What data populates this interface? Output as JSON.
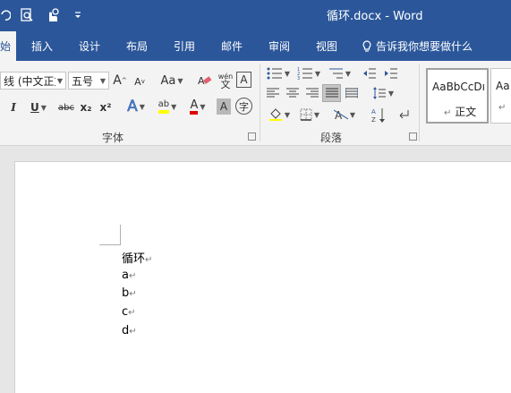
{
  "window": {
    "title": "循环.docx  -  Word",
    "colors": {
      "titlebar": "#2b579a",
      "ribbon": "#f3f3f3",
      "page": "#ffffff"
    }
  },
  "quick_access": {
    "icons": [
      "undo-icon",
      "print-preview-icon",
      "touch-mode-icon",
      "customize-chevron-icon"
    ]
  },
  "ribbon_tabs": [
    {
      "label": "始"
    },
    {
      "label": "插入"
    },
    {
      "label": "设计"
    },
    {
      "label": "布局"
    },
    {
      "label": "引用"
    },
    {
      "label": "邮件"
    },
    {
      "label": "审阅"
    },
    {
      "label": "视图"
    }
  ],
  "tell_me": "告诉我你想要做什么",
  "font_group": {
    "font_name": "线 (中文正文)",
    "font_size": "五号",
    "grow_label": "A",
    "shrink_label": "A",
    "change_case": "Aa",
    "phonetic_top": "wén",
    "phonetic_bottom": "文",
    "border_char": "A",
    "italic": "I",
    "underline": "U",
    "strike": "abc",
    "subscript": "x₂",
    "superscript": "x²",
    "text_effects": "A",
    "highlight": "ab",
    "font_color": "A",
    "char_shading": "A",
    "enclose_char": "字",
    "label": "字体"
  },
  "paragraph_group": {
    "label": "段落"
  },
  "styles": [
    {
      "preview": "AaBbCcDı",
      "name": "正文"
    },
    {
      "preview": "Aa",
      "name": ""
    }
  ],
  "document": {
    "lines": [
      "循环",
      "a",
      "b",
      "c",
      "d"
    ],
    "paragraph_mark": "↵"
  }
}
